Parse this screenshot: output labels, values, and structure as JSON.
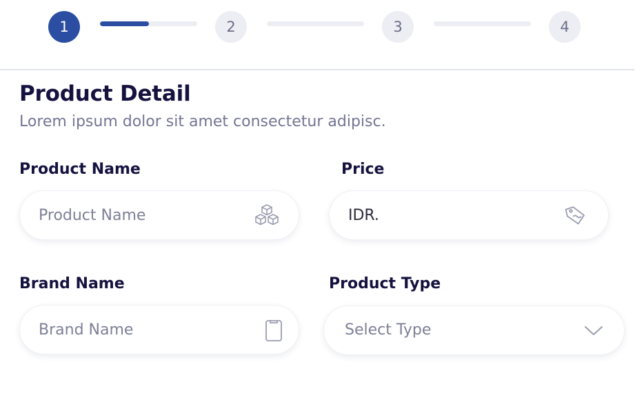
{
  "stepper": {
    "steps": [
      "1",
      "2",
      "3",
      "4"
    ],
    "active_step": 1,
    "progress_first_segment": 0.5
  },
  "header": {
    "title": "Product Detail",
    "subtitle": "Lorem ipsum dolor sit amet consectetur adipisc."
  },
  "form": {
    "product_name": {
      "label": "Product Name",
      "placeholder": "Product Name",
      "value": "",
      "icon": "boxes-icon"
    },
    "price": {
      "label": "Price",
      "placeholder": "",
      "value": "IDR.",
      "icon": "price-tag-icon"
    },
    "brand_name": {
      "label": "Brand Name",
      "placeholder": "Brand Name",
      "value": "",
      "icon": "clipboard-icon"
    },
    "product_type": {
      "label": "Product Type",
      "selected": "Select Type",
      "icon": "chevron-down-icon"
    }
  },
  "colors": {
    "accent": "#2b4ea2",
    "heading": "#15123f",
    "muted": "#747594",
    "inactive_step": "#eceef4"
  }
}
